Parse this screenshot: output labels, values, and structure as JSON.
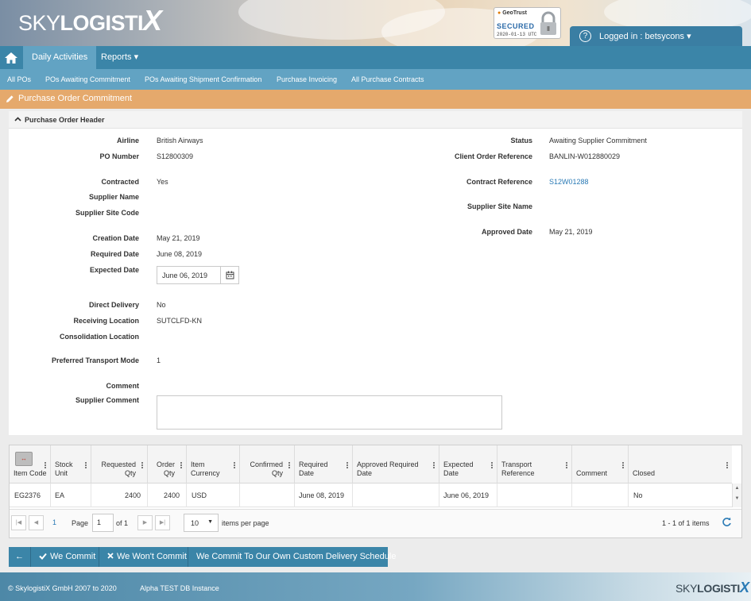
{
  "brand": {
    "logo_light": "SKY",
    "logo_bold": "LOGISTI",
    "logo_x": "X"
  },
  "security_seal": {
    "brand": "GeoTrust",
    "status": "SECURED",
    "date": "2020-01-13 UTC"
  },
  "user": {
    "logged_in_text": "Logged in : betsycons ▾"
  },
  "nav": {
    "items": [
      {
        "label": "Daily Activities"
      },
      {
        "label": "Reports ▾"
      }
    ],
    "subnav": [
      {
        "label": "All POs"
      },
      {
        "label": "POs Awaiting Commitment"
      },
      {
        "label": "POs Awaiting Shipment Confirmation"
      },
      {
        "label": "Purchase Invoicing"
      },
      {
        "label": "All Purchase Contracts"
      }
    ]
  },
  "page": {
    "section_title": "Purchase Order Commitment",
    "panel_title": "Purchase Order Header"
  },
  "form": {
    "airline": {
      "label": "Airline",
      "value": "British Airways"
    },
    "po_number": {
      "label": "PO Number",
      "value": "S12800309"
    },
    "contracted": {
      "label": "Contracted",
      "value": "Yes"
    },
    "supplier_name": {
      "label": "Supplier Name",
      "value": ""
    },
    "supplier_site_code": {
      "label": "Supplier Site Code",
      "value": ""
    },
    "creation_date": {
      "label": "Creation Date",
      "value": "May 21, 2019"
    },
    "required_date": {
      "label": "Required Date",
      "value": "June 08, 2019"
    },
    "expected_date": {
      "label": "Expected Date",
      "value": "June 06, 2019"
    },
    "direct_delivery": {
      "label": "Direct Delivery",
      "value": "No"
    },
    "receiving_location": {
      "label": "Receiving Location",
      "value": "SUTCLFD-KN"
    },
    "consolidation_location": {
      "label": "Consolidation Location",
      "value": ""
    },
    "transport_mode": {
      "label": "Preferred Transport Mode",
      "value": "1"
    },
    "comment": {
      "label": "Comment",
      "value": ""
    },
    "supplier_comment": {
      "label": "Supplier Comment",
      "value": ""
    },
    "status": {
      "label": "Status",
      "value": "Awaiting Supplier Commitment"
    },
    "client_order_ref": {
      "label": "Client Order Reference",
      "value": "BANLIN-W012880029"
    },
    "contract_ref": {
      "label": "Contract Reference",
      "value": "S12W01288"
    },
    "supplier_site_name": {
      "label": "Supplier Site Name",
      "value": ""
    },
    "approved_date": {
      "label": "Approved Date",
      "value": "May 21, 2019"
    }
  },
  "grid": {
    "expand_glyph": "↔",
    "columns": [
      "Item Code",
      "Stock Unit",
      "Requested Qty",
      "Order Qty",
      "Item Currency",
      "Confirmed Qty",
      "Required Date",
      "Approved Required Date",
      "Expected Date",
      "Transport Reference",
      "Comment",
      "Closed"
    ],
    "rows": [
      [
        "EG2376",
        "EA",
        "2400",
        "2400",
        "USD",
        "",
        "June 08, 2019",
        "",
        "June 06, 2019",
        "",
        "",
        "No"
      ]
    ],
    "pager": {
      "current_page": "1",
      "page_label": "Page",
      "of_label": "of 1",
      "page_size": "10",
      "per_page_label": "items per page",
      "summary": "1 - 1 of 1 items"
    }
  },
  "actions": {
    "back": "←",
    "commit": "We Commit",
    "wont_commit": "We Won't Commit",
    "custom_schedule": "We Commit To Our Own Custom Delivery Schedule"
  },
  "footer": {
    "copyright": "© SkylogistiX GmbH 2007 to 2020",
    "environment": "Alpha TEST DB Instance",
    "logo_light": "SKY",
    "logo_bold": "LOGISTI",
    "logo_x": "X"
  },
  "colors": {
    "nav": "#3b85a8",
    "subnav": "#62a3c3",
    "section_bar": "#e5a96c",
    "link": "#2a7ab5"
  }
}
